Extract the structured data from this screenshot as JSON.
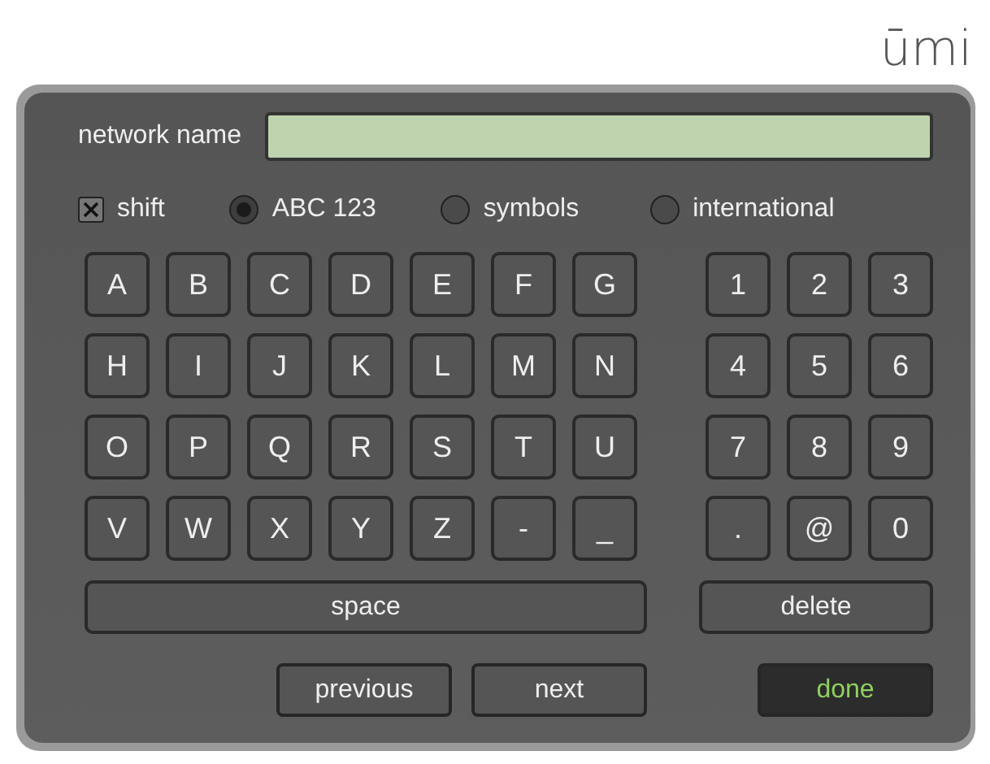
{
  "logo": "ūmi",
  "field": {
    "label": "network name"
  },
  "shift": {
    "label": "shift",
    "checked": true
  },
  "modes": [
    {
      "label": "ABC 123",
      "selected": true
    },
    {
      "label": "symbols",
      "selected": false
    },
    {
      "label": "international",
      "selected": false
    }
  ],
  "letter_keys": [
    [
      "A",
      "B",
      "C",
      "D",
      "E",
      "F",
      "G"
    ],
    [
      "H",
      "I",
      "J",
      "K",
      "L",
      "M",
      "N"
    ],
    [
      "O",
      "P",
      "Q",
      "R",
      "S",
      "T",
      "U"
    ],
    [
      "V",
      "W",
      "X",
      "Y",
      "Z",
      "-",
      "_"
    ]
  ],
  "number_keys": [
    [
      "1",
      "2",
      "3"
    ],
    [
      "4",
      "5",
      "6"
    ],
    [
      "7",
      "8",
      "9"
    ],
    [
      ".",
      "@",
      "0"
    ]
  ],
  "space_key": "space",
  "delete_key": "delete",
  "buttons": [
    {
      "label": "previous",
      "kind": "nav"
    },
    {
      "label": "next",
      "kind": "nav"
    },
    {
      "label": "done",
      "kind": "confirm"
    }
  ]
}
